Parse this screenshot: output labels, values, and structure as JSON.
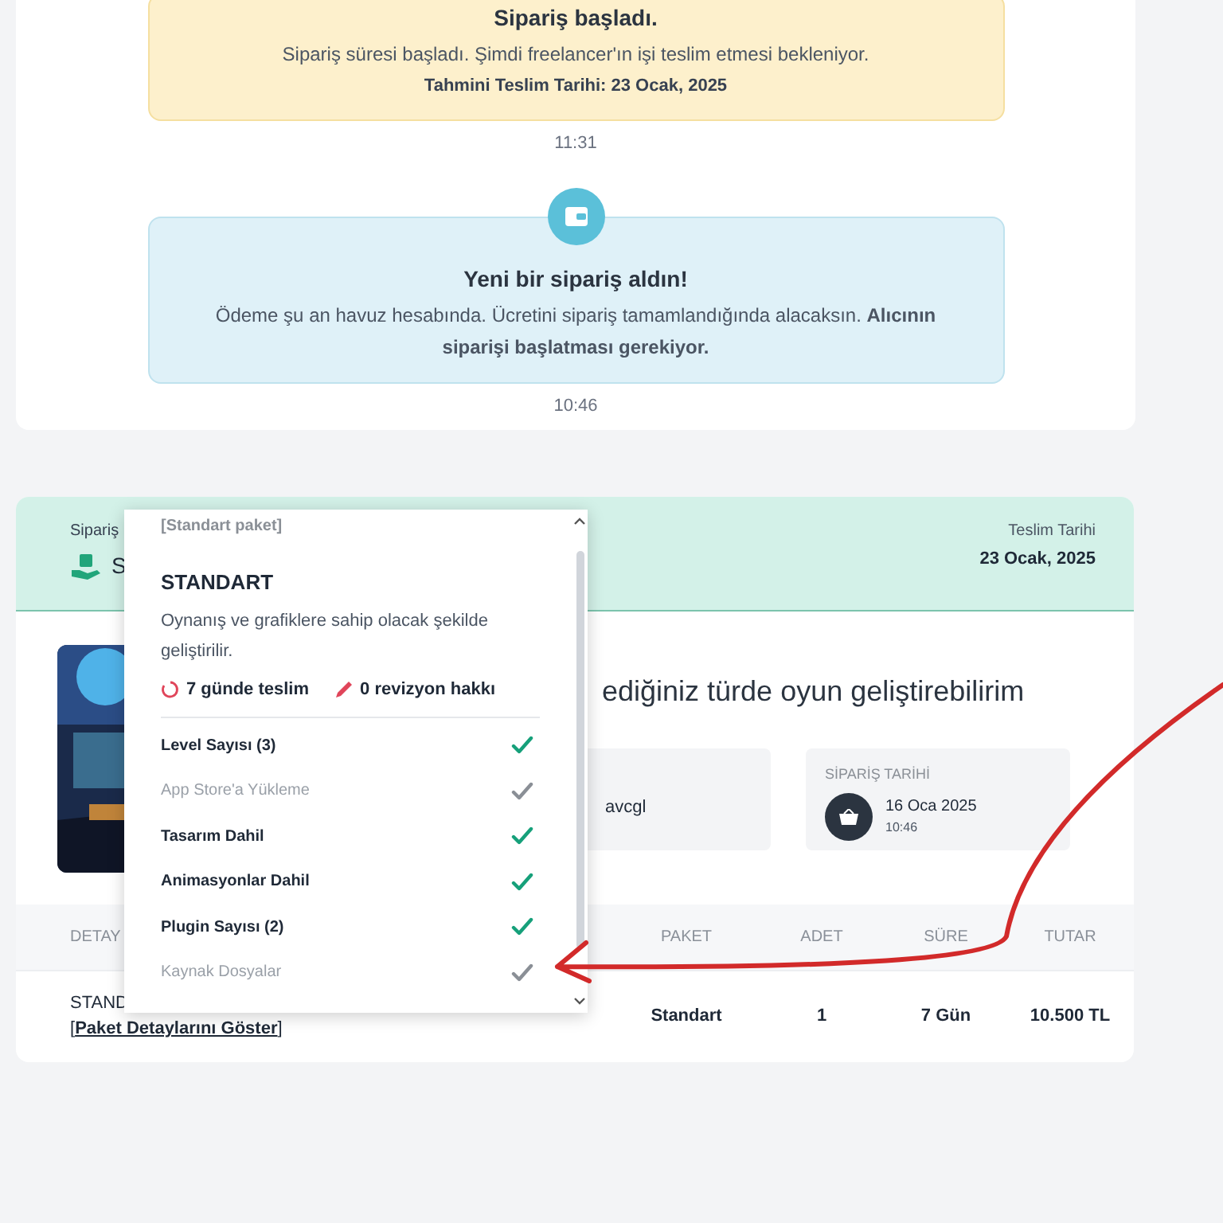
{
  "timeline": [
    {
      "kind": "started",
      "title": "Sipariş başladı.",
      "text": "Sipariş süresi başladı. Şimdi freelancer'ın işi teslim etmesi bekleniyor.",
      "note": "Tahmini Teslim Tarihi: 23 Ocak, 2025",
      "time": "11:31"
    },
    {
      "kind": "new_order",
      "title": "Yeni bir sipariş aldın!",
      "text": "Ödeme şu an havuz hesabında. Ücretini sipariş tamamlandığında alacaksın. **Alıcının siparişi başlatması gerekiyor.**",
      "time": "10:46"
    }
  ],
  "order": {
    "header_label": "Sipariş",
    "header_title": "S",
    "delivery_label": "Teslim Tarihi",
    "delivery_date": "23 Ocak, 2025",
    "title": "ediğiniz türde oyun geliştirebilirim",
    "seller_value": "avcgl",
    "order_date_label": "SİPARİŞ TARİHİ",
    "order_date": "16 Oca 2025",
    "order_time": "10:46",
    "table": {
      "columns": [
        "DETAY",
        "PAKET",
        "ADET",
        "SÜRE",
        "TUTAR"
      ],
      "row": {
        "detail": "STAND",
        "link_open": "[",
        "link_close": "]",
        "link": "Paket Detaylarını Göster",
        "package": "Standart",
        "quantity": "1",
        "duration": "7 Gün",
        "total": "10.500 TL"
      }
    }
  },
  "popup": {
    "tag": "[Standart paket]",
    "name": "STANDART",
    "description": "Oynanış ve grafiklere sahip olacak şekilde geliştirilir.",
    "delivery": "7 günde teslim",
    "revisions": "0 revizyon hakkı",
    "features": [
      {
        "label": "Level Sayısı (3)",
        "included": true
      },
      {
        "label": "App Store'a Yükleme",
        "included": false
      },
      {
        "label": "Tasarım Dahil",
        "included": true
      },
      {
        "label": "Animasyonlar Dahil",
        "included": true
      },
      {
        "label": "Plugin Sayısı (2)",
        "included": true
      },
      {
        "label": "Kaynak Dosyalar",
        "included": false
      }
    ]
  }
}
